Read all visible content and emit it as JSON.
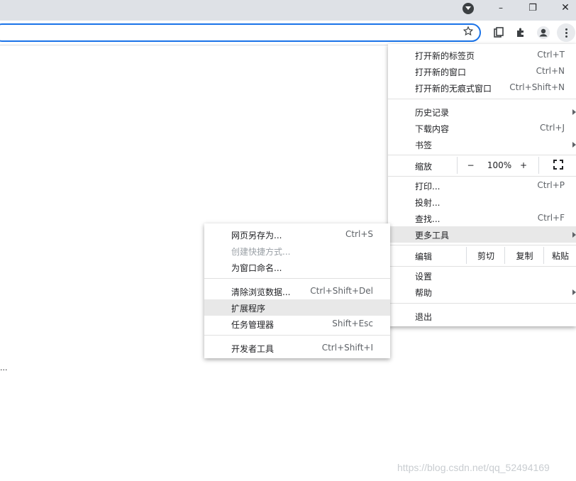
{
  "window": {
    "minimize": "–",
    "restore": "❐",
    "close": "✕"
  },
  "main_menu": {
    "items": [
      {
        "label": "打开新的标签页",
        "shortcut": "Ctrl+T"
      },
      {
        "label": "打开新的窗口",
        "shortcut": "Ctrl+N"
      },
      {
        "label": "打开新的无痕式窗口",
        "shortcut": "Ctrl+Shift+N"
      },
      {
        "label": "历史记录",
        "shortcut": ""
      },
      {
        "label": "下载内容",
        "shortcut": "Ctrl+J"
      },
      {
        "label": "书签",
        "shortcut": ""
      },
      {
        "label": "打印...",
        "shortcut": "Ctrl+P"
      },
      {
        "label": "投射...",
        "shortcut": ""
      },
      {
        "label": "查找...",
        "shortcut": "Ctrl+F"
      },
      {
        "label": "更多工具",
        "shortcut": ""
      },
      {
        "label": "设置",
        "shortcut": ""
      },
      {
        "label": "帮助",
        "shortcut": ""
      },
      {
        "label": "退出",
        "shortcut": ""
      }
    ],
    "zoom": {
      "label": "缩放",
      "minus": "−",
      "value": "100%",
      "plus": "+"
    },
    "edit": {
      "label": "编辑",
      "cut": "剪切",
      "copy": "复制",
      "paste": "粘贴"
    }
  },
  "sub_menu": {
    "items": [
      {
        "label": "网页另存为...",
        "shortcut": "Ctrl+S"
      },
      {
        "label": "创建快捷方式...",
        "shortcut": ""
      },
      {
        "label": "为窗口命名...",
        "shortcut": ""
      },
      {
        "label": "清除浏览数据...",
        "shortcut": "Ctrl+Shift+Del"
      },
      {
        "label": "扩展程序",
        "shortcut": ""
      },
      {
        "label": "任务管理器",
        "shortcut": "Shift+Esc"
      },
      {
        "label": "开发者工具",
        "shortcut": "Ctrl+Shift+I"
      }
    ]
  },
  "page": {
    "ellipsis": "..."
  },
  "watermark": "https://blog.csdn.net/qq_52494169",
  "colors": {
    "accent": "#1a73e8",
    "titlebar": "#dee1e6",
    "highlight": "#e8e8e8"
  }
}
